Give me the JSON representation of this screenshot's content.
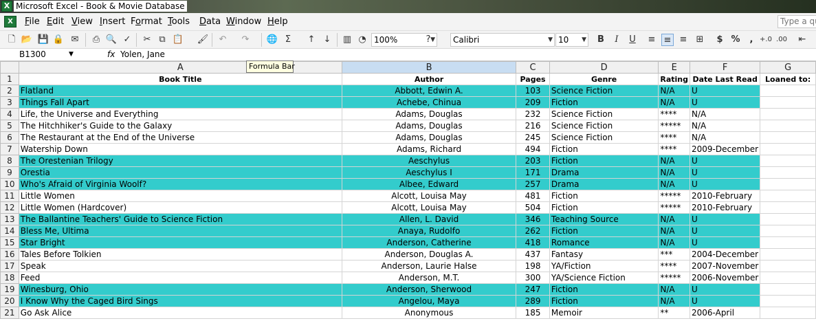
{
  "window": {
    "title": "Microsoft Excel - Book & Movie Database"
  },
  "menu": {
    "items": [
      {
        "label": "File",
        "u": "F"
      },
      {
        "label": "Edit",
        "u": "E"
      },
      {
        "label": "View",
        "u": "V"
      },
      {
        "label": "Insert",
        "u": "I"
      },
      {
        "label": "Format",
        "u": "o"
      },
      {
        "label": "Tools",
        "u": "T"
      },
      {
        "label": "Data",
        "u": "D"
      },
      {
        "label": "Window",
        "u": "W"
      },
      {
        "label": "Help",
        "u": "H"
      }
    ],
    "type_question": "Type a qu"
  },
  "toolbar": {
    "zoom": "100%",
    "font": "Calibri",
    "font_size": "10",
    "bold": "B",
    "italic": "I",
    "underline": "U",
    "currency": "$",
    "percent": "%",
    "comma": ",",
    "sum": "Σ"
  },
  "formula_bar": {
    "name_box": "B1300",
    "fx": "fx",
    "content": "Yolen, Jane",
    "tooltip": "Formula Bar"
  },
  "sheet": {
    "columns": [
      "A",
      "B",
      "C",
      "D",
      "E",
      "F",
      "G"
    ],
    "header_row": {
      "row_num": "1",
      "cells": [
        "Book Title",
        "Author",
        "Pages",
        "Genre",
        "Rating",
        "Date Last Read",
        "Loaned to:"
      ]
    },
    "rows": [
      {
        "n": "2",
        "teal": true,
        "title": "Flatland",
        "author": "Abbott, Edwin A.",
        "pages": "103",
        "genre": "Science Fiction",
        "rating": "N/A",
        "date": "U"
      },
      {
        "n": "3",
        "teal": true,
        "title": "Things Fall Apart",
        "author": "Achebe, Chinua",
        "pages": "209",
        "genre": "Fiction",
        "rating": "N/A",
        "date": "U"
      },
      {
        "n": "4",
        "teal": false,
        "title": "Life, the Universe and Everything",
        "author": "Adams, Douglas",
        "pages": "232",
        "genre": "Science Fiction",
        "rating": "****",
        "date": "N/A"
      },
      {
        "n": "5",
        "teal": false,
        "title": "The Hitchhiker's Guide to the Galaxy",
        "author": "Adams, Douglas",
        "pages": "216",
        "genre": "Science Fiction",
        "rating": "*****",
        "date": "N/A"
      },
      {
        "n": "6",
        "teal": false,
        "title": "The Restaurant at the End of the Universe",
        "author": "Adams, Douglas",
        "pages": "245",
        "genre": "Science Fiction",
        "rating": "****",
        "date": "N/A"
      },
      {
        "n": "7",
        "teal": false,
        "title": "Watership Down",
        "author": "Adams, Richard",
        "pages": "494",
        "genre": "Fiction",
        "rating": "****",
        "date": "2009-December"
      },
      {
        "n": "8",
        "teal": true,
        "title": "The Orestenian Trilogy",
        "author": "Aeschylus",
        "pages": "203",
        "genre": "Fiction",
        "rating": "N/A",
        "date": "U"
      },
      {
        "n": "9",
        "teal": true,
        "title": "Orestia",
        "author": "Aeschylus I",
        "pages": "171",
        "genre": "Drama",
        "rating": "N/A",
        "date": "U"
      },
      {
        "n": "10",
        "teal": true,
        "title": "Who's Afraid of Virginia Woolf?",
        "author": "Albee, Edward",
        "pages": "257",
        "genre": "Drama",
        "rating": "N/A",
        "date": "U"
      },
      {
        "n": "11",
        "teal": false,
        "title": "Little Women",
        "author": "Alcott, Louisa May",
        "pages": "481",
        "genre": "Fiction",
        "rating": "*****",
        "date": "2010-February"
      },
      {
        "n": "12",
        "teal": false,
        "title": "Little Women (Hardcover)",
        "author": "Alcott, Louisa May",
        "pages": "504",
        "genre": "Fiction",
        "rating": "*****",
        "date": "2010-February"
      },
      {
        "n": "13",
        "teal": true,
        "title": "The Ballantine Teachers' Guide to Science Fiction",
        "author": "Allen, L. David",
        "pages": "346",
        "genre": "Teaching Source",
        "rating": "N/A",
        "date": "U"
      },
      {
        "n": "14",
        "teal": true,
        "title": "Bless Me, Ultima",
        "author": "Anaya, Rudolfo",
        "pages": "262",
        "genre": "Fiction",
        "rating": "N/A",
        "date": "U"
      },
      {
        "n": "15",
        "teal": true,
        "title": "Star Bright",
        "author": "Anderson, Catherine",
        "pages": "418",
        "genre": "Romance",
        "rating": "N/A",
        "date": "U"
      },
      {
        "n": "16",
        "teal": false,
        "title": "Tales Before Tolkien",
        "author": "Anderson, Douglas A.",
        "pages": "437",
        "genre": "Fantasy",
        "rating": "***",
        "date": "2004-December"
      },
      {
        "n": "17",
        "teal": false,
        "title": "Speak",
        "author": "Anderson, Laurie Halse",
        "pages": "198",
        "genre": "YA/Fiction",
        "rating": "****",
        "date": "2007-November"
      },
      {
        "n": "18",
        "teal": false,
        "title": "Feed",
        "author": "Anderson, M.T.",
        "pages": "300",
        "genre": "YA/Science Fiction",
        "rating": "*****",
        "date": "2006-November"
      },
      {
        "n": "19",
        "teal": true,
        "title": "Winesburg, Ohio",
        "author": "Anderson, Sherwood",
        "pages": "247",
        "genre": "Fiction",
        "rating": "N/A",
        "date": "U"
      },
      {
        "n": "20",
        "teal": true,
        "title": "I Know Why the Caged Bird Sings",
        "author": "Angelou, Maya",
        "pages": "289",
        "genre": "Fiction",
        "rating": "N/A",
        "date": "U"
      },
      {
        "n": "21",
        "teal": false,
        "title": "Go Ask Alice",
        "author": "Anonymous",
        "pages": "185",
        "genre": "Memoir",
        "rating": "**",
        "date": "2006-April"
      }
    ]
  },
  "colors": {
    "teal": "#33cccc",
    "selected_column": "#c8ddf2"
  }
}
